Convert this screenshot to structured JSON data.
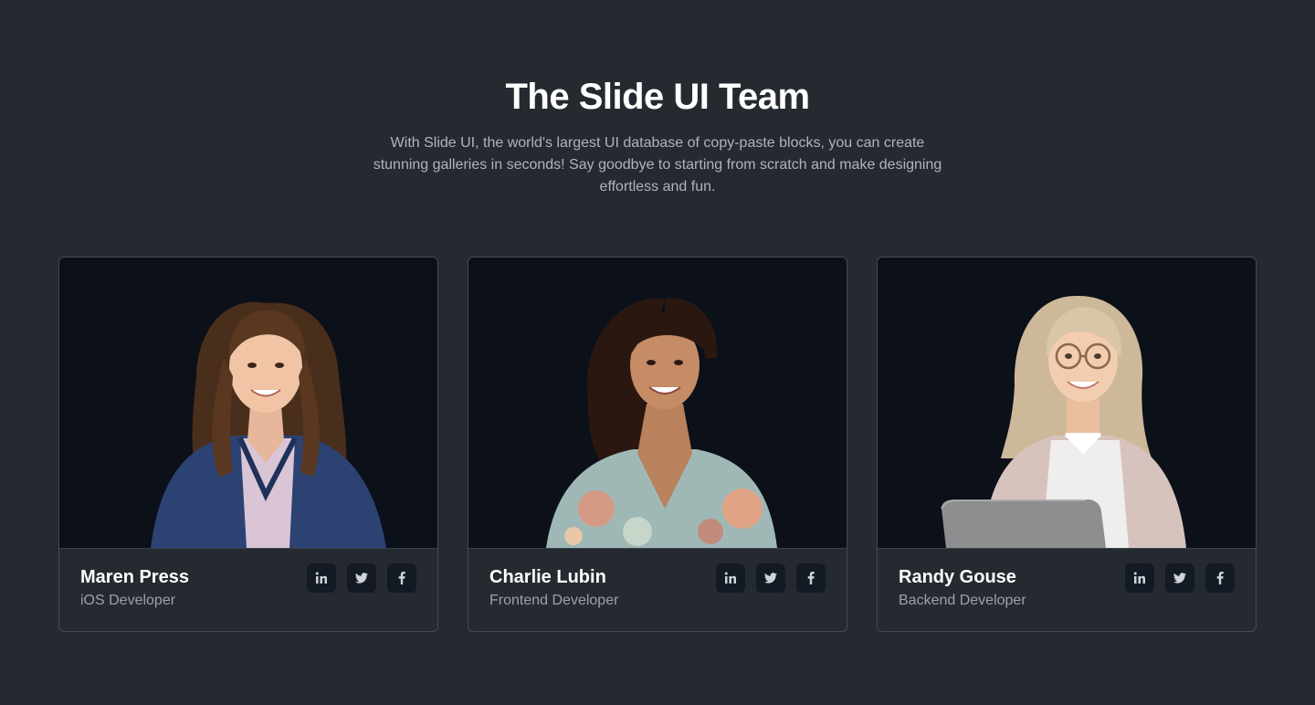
{
  "section": {
    "title": "The Slide UI Team",
    "subtitle": "With Slide UI, the world's largest UI database of copy-paste blocks, you can create stunning galleries in seconds! Say goodbye to starting from scratch and make designing effortless and fun."
  },
  "members": [
    {
      "name": "Maren Press",
      "role": "iOS Developer",
      "photo": "portrait-woman-navy-blazer",
      "socials": [
        "linkedin-icon",
        "twitter-icon",
        "facebook-icon"
      ]
    },
    {
      "name": "Charlie Lubin",
      "role": "Frontend Developer",
      "photo": "portrait-woman-floral-shirt",
      "socials": [
        "linkedin-icon",
        "twitter-icon",
        "facebook-icon"
      ]
    },
    {
      "name": "Randy Gouse",
      "role": "Backend Developer",
      "photo": "portrait-woman-glasses-laptop",
      "socials": [
        "linkedin-icon",
        "twitter-icon",
        "facebook-icon"
      ]
    }
  ],
  "colors": {
    "background": "#252a31",
    "photo_background": "#0b1019",
    "social_button": "#141a23",
    "title": "#ffffff",
    "muted_text": "#9aa1ab"
  }
}
